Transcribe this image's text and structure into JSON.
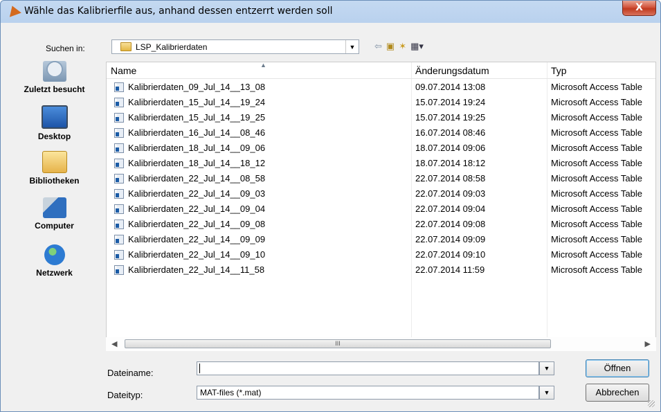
{
  "window": {
    "title": "Wähle das Kalibrierfile aus, anhand dessen entzerrt werden soll",
    "close_label": "X"
  },
  "lookin": {
    "label": "Suchen in:",
    "folder": "LSP_Kalibrierdaten"
  },
  "toolbar": {
    "back_icon": "back-arrow-icon",
    "up_icon": "up-folder-icon",
    "new_folder_icon": "new-folder-icon",
    "view_icon": "view-menu-icon"
  },
  "places": [
    {
      "label": "Zuletzt besucht",
      "icon": "recent-places-icon"
    },
    {
      "label": "Desktop",
      "icon": "desktop-icon"
    },
    {
      "label": "Bibliotheken",
      "icon": "libraries-icon"
    },
    {
      "label": "Computer",
      "icon": "computer-icon"
    },
    {
      "label": "Netzwerk",
      "icon": "network-icon"
    }
  ],
  "columns": {
    "name": "Name",
    "date": "Änderungsdatum",
    "type": "Typ"
  },
  "files": [
    {
      "name": "Kalibrierdaten_09_Jul_14__13_08",
      "date": "09.07.2014 13:08",
      "type": "Microsoft Access Table"
    },
    {
      "name": "Kalibrierdaten_15_Jul_14__19_24",
      "date": "15.07.2014 19:24",
      "type": "Microsoft Access Table"
    },
    {
      "name": "Kalibrierdaten_15_Jul_14__19_25",
      "date": "15.07.2014 19:25",
      "type": "Microsoft Access Table"
    },
    {
      "name": "Kalibrierdaten_16_Jul_14__08_46",
      "date": "16.07.2014 08:46",
      "type": "Microsoft Access Table"
    },
    {
      "name": "Kalibrierdaten_18_Jul_14__09_06",
      "date": "18.07.2014 09:06",
      "type": "Microsoft Access Table"
    },
    {
      "name": "Kalibrierdaten_18_Jul_14__18_12",
      "date": "18.07.2014 18:12",
      "type": "Microsoft Access Table"
    },
    {
      "name": "Kalibrierdaten_22_Jul_14__08_58",
      "date": "22.07.2014 08:58",
      "type": "Microsoft Access Table"
    },
    {
      "name": "Kalibrierdaten_22_Jul_14__09_03",
      "date": "22.07.2014 09:03",
      "type": "Microsoft Access Table"
    },
    {
      "name": "Kalibrierdaten_22_Jul_14__09_04",
      "date": "22.07.2014 09:04",
      "type": "Microsoft Access Table"
    },
    {
      "name": "Kalibrierdaten_22_Jul_14__09_08",
      "date": "22.07.2014 09:08",
      "type": "Microsoft Access Table"
    },
    {
      "name": "Kalibrierdaten_22_Jul_14__09_09",
      "date": "22.07.2014 09:09",
      "type": "Microsoft Access Table"
    },
    {
      "name": "Kalibrierdaten_22_Jul_14__09_10",
      "date": "22.07.2014 09:10",
      "type": "Microsoft Access Table"
    },
    {
      "name": "Kalibrierdaten_22_Jul_14__11_58",
      "date": "22.07.2014 11:59",
      "type": "Microsoft Access Table"
    }
  ],
  "filename": {
    "label": "Dateiname:",
    "value": ""
  },
  "filetype": {
    "label": "Dateityp:",
    "value": "MAT-files (*.mat)"
  },
  "buttons": {
    "open": "Öffnen",
    "cancel": "Abbrechen"
  },
  "scrollbar": {
    "thumb_grip": "III"
  }
}
